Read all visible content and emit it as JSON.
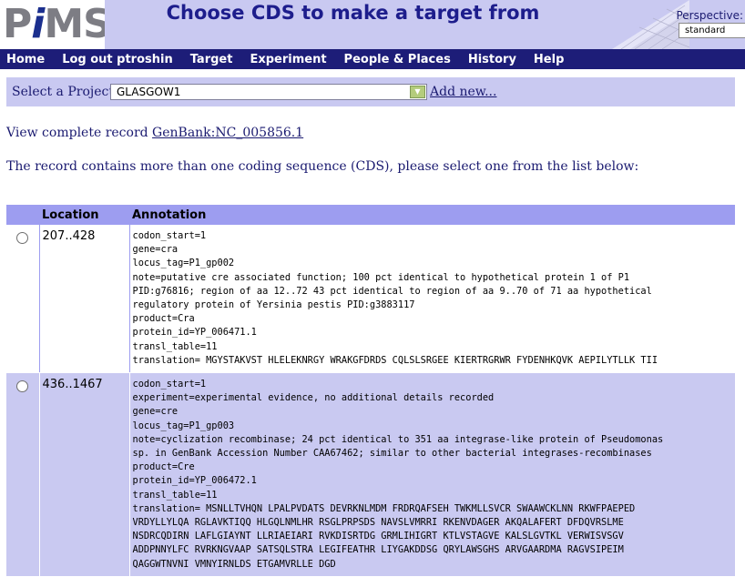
{
  "header": {
    "logo_prefix": "P",
    "logo_i": "i",
    "logo_suffix": "MS",
    "title": "Choose CDS to make a target from",
    "perspective_label": "Perspective:",
    "perspective_value": "standard"
  },
  "nav": {
    "items": [
      "Home",
      "Log out ptroshin",
      "Target",
      "Experiment",
      "People & Places",
      "History",
      "Help"
    ]
  },
  "project": {
    "label": "Select a Project:",
    "value": "GLASGOW1",
    "add_new": "Add new..."
  },
  "record": {
    "prefix": "View complete record",
    "link": "GenBank:NC_005856.1"
  },
  "intro": "The record contains more than one coding sequence (CDS), please select one from the list below:",
  "table": {
    "headers": [
      "Location",
      "Annotation"
    ],
    "rows": [
      {
        "location": "207..428",
        "annotation": [
          "codon_start=1",
          "gene=cra",
          "locus_tag=P1_gp002",
          "note=putative cre associated function; 100 pct identical to hypothetical protein 1 of P1",
          "PID:g76816; region of aa 12..72 43 pct identical to region of aa 9..70 of 71 aa hypothetical",
          "regulatory protein of Yersinia pestis PID:g3883117",
          "product=Cra",
          "protein_id=YP_006471.1",
          "transl_table=11",
          "translation= MGYSTAKVST HLELEKNRGY WRAKGFDRDS CQLSLSRGEE KIERTRGRWR FYDENHKQVK AEPILYTLLK TII"
        ]
      },
      {
        "location": "436..1467",
        "annotation": [
          "codon_start=1",
          "experiment=experimental evidence, no additional details recorded",
          "gene=cre",
          "locus_tag=P1_gp003",
          "note=cyclization recombinase; 24 pct identical to 351 aa integrase-like protein of Pseudomonas",
          "sp. in GenBank Accession Number CAA67462; similar to other bacterial integrases-recombinases",
          "product=Cre",
          "protein_id=YP_006472.1",
          "transl_table=11",
          "translation= MSNLLTVHQN LPALPVDATS DEVRKNLMDM FRDRQAFSEH TWKMLLSVCR SWAAWCKLNN RKWFPAEPED",
          "VRDYLLYLQA RGLAVKTIQQ HLGQLNMLHR RSGLPRPSDS NAVSLVMRRI RKENVDAGER AKQALAFERT DFDQVRSLME",
          "NSDRCQDIRN LAFLGIAYNT LLRIAEIARI RVKDISRTDG GRMLIHIGRT KTLVSTAGVE KALSLGVTKL VERWISVSGV",
          "ADDPNNYLFC RVRKNGVAAP SATSQLSTRA LEGIFEATHR LIYGAKDDSG QRYLAWSGHS ARVGAARDMA RAGVSIPEIM",
          "QAGGWTNVNI VMNYIRNLDS ETGAMVRLLE DGD"
        ]
      }
    ]
  }
}
